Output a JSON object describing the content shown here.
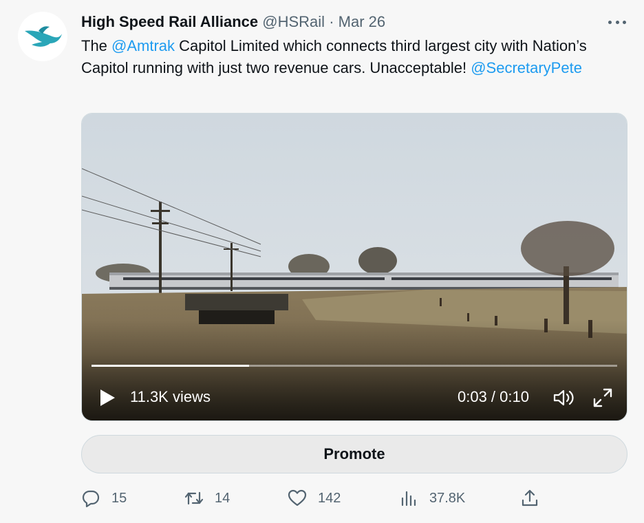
{
  "tweet": {
    "author_name": "High Speed Rail Alliance",
    "handle": "@HSRail",
    "separator": "·",
    "date": "Mar 26",
    "text": {
      "part1": "The ",
      "mention1": "@Amtrak",
      "part2": " Capitol Limited which connects third largest city with Nation’s Capitol running with just two revenue cars.  Unacceptable! ",
      "mention2": "@SecretaryPete"
    }
  },
  "video": {
    "views_label": "11.3K views",
    "timecode": "0:03 / 0:10",
    "progress_fraction": 0.3
  },
  "promote": {
    "label": "Promote"
  },
  "actions": {
    "replies": "15",
    "retweets": "14",
    "likes": "142",
    "views": "37.8K"
  },
  "icons": {
    "avatar": "bird-logo-icon",
    "more": "more-dots-icon",
    "play": "play-icon",
    "volume": "volume-icon",
    "fullscreen": "fullscreen-icon",
    "reply": "reply-icon",
    "retweet": "retweet-icon",
    "like": "heart-icon",
    "analytics": "analytics-icon",
    "share": "share-icon"
  },
  "colors": {
    "link": "#1d9bf0",
    "muted": "#536471",
    "brand_teal": "#2aa6b8"
  }
}
